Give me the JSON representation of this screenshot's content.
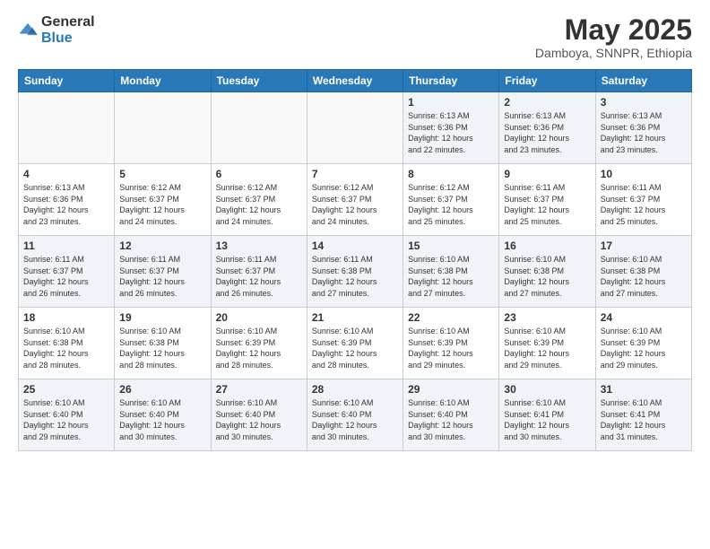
{
  "logo": {
    "line1": "General",
    "line2": "Blue"
  },
  "title": "May 2025",
  "location": "Damboya, SNNPR, Ethiopia",
  "weekdays": [
    "Sunday",
    "Monday",
    "Tuesday",
    "Wednesday",
    "Thursday",
    "Friday",
    "Saturday"
  ],
  "weeks": [
    [
      {
        "day": "",
        "info": ""
      },
      {
        "day": "",
        "info": ""
      },
      {
        "day": "",
        "info": ""
      },
      {
        "day": "",
        "info": ""
      },
      {
        "day": "1",
        "info": "Sunrise: 6:13 AM\nSunset: 6:36 PM\nDaylight: 12 hours\nand 22 minutes."
      },
      {
        "day": "2",
        "info": "Sunrise: 6:13 AM\nSunset: 6:36 PM\nDaylight: 12 hours\nand 23 minutes."
      },
      {
        "day": "3",
        "info": "Sunrise: 6:13 AM\nSunset: 6:36 PM\nDaylight: 12 hours\nand 23 minutes."
      }
    ],
    [
      {
        "day": "4",
        "info": "Sunrise: 6:13 AM\nSunset: 6:36 PM\nDaylight: 12 hours\nand 23 minutes."
      },
      {
        "day": "5",
        "info": "Sunrise: 6:12 AM\nSunset: 6:37 PM\nDaylight: 12 hours\nand 24 minutes."
      },
      {
        "day": "6",
        "info": "Sunrise: 6:12 AM\nSunset: 6:37 PM\nDaylight: 12 hours\nand 24 minutes."
      },
      {
        "day": "7",
        "info": "Sunrise: 6:12 AM\nSunset: 6:37 PM\nDaylight: 12 hours\nand 24 minutes."
      },
      {
        "day": "8",
        "info": "Sunrise: 6:12 AM\nSunset: 6:37 PM\nDaylight: 12 hours\nand 25 minutes."
      },
      {
        "day": "9",
        "info": "Sunrise: 6:11 AM\nSunset: 6:37 PM\nDaylight: 12 hours\nand 25 minutes."
      },
      {
        "day": "10",
        "info": "Sunrise: 6:11 AM\nSunset: 6:37 PM\nDaylight: 12 hours\nand 25 minutes."
      }
    ],
    [
      {
        "day": "11",
        "info": "Sunrise: 6:11 AM\nSunset: 6:37 PM\nDaylight: 12 hours\nand 26 minutes."
      },
      {
        "day": "12",
        "info": "Sunrise: 6:11 AM\nSunset: 6:37 PM\nDaylight: 12 hours\nand 26 minutes."
      },
      {
        "day": "13",
        "info": "Sunrise: 6:11 AM\nSunset: 6:37 PM\nDaylight: 12 hours\nand 26 minutes."
      },
      {
        "day": "14",
        "info": "Sunrise: 6:11 AM\nSunset: 6:38 PM\nDaylight: 12 hours\nand 27 minutes."
      },
      {
        "day": "15",
        "info": "Sunrise: 6:10 AM\nSunset: 6:38 PM\nDaylight: 12 hours\nand 27 minutes."
      },
      {
        "day": "16",
        "info": "Sunrise: 6:10 AM\nSunset: 6:38 PM\nDaylight: 12 hours\nand 27 minutes."
      },
      {
        "day": "17",
        "info": "Sunrise: 6:10 AM\nSunset: 6:38 PM\nDaylight: 12 hours\nand 27 minutes."
      }
    ],
    [
      {
        "day": "18",
        "info": "Sunrise: 6:10 AM\nSunset: 6:38 PM\nDaylight: 12 hours\nand 28 minutes."
      },
      {
        "day": "19",
        "info": "Sunrise: 6:10 AM\nSunset: 6:38 PM\nDaylight: 12 hours\nand 28 minutes."
      },
      {
        "day": "20",
        "info": "Sunrise: 6:10 AM\nSunset: 6:39 PM\nDaylight: 12 hours\nand 28 minutes."
      },
      {
        "day": "21",
        "info": "Sunrise: 6:10 AM\nSunset: 6:39 PM\nDaylight: 12 hours\nand 28 minutes."
      },
      {
        "day": "22",
        "info": "Sunrise: 6:10 AM\nSunset: 6:39 PM\nDaylight: 12 hours\nand 29 minutes."
      },
      {
        "day": "23",
        "info": "Sunrise: 6:10 AM\nSunset: 6:39 PM\nDaylight: 12 hours\nand 29 minutes."
      },
      {
        "day": "24",
        "info": "Sunrise: 6:10 AM\nSunset: 6:39 PM\nDaylight: 12 hours\nand 29 minutes."
      }
    ],
    [
      {
        "day": "25",
        "info": "Sunrise: 6:10 AM\nSunset: 6:40 PM\nDaylight: 12 hours\nand 29 minutes."
      },
      {
        "day": "26",
        "info": "Sunrise: 6:10 AM\nSunset: 6:40 PM\nDaylight: 12 hours\nand 30 minutes."
      },
      {
        "day": "27",
        "info": "Sunrise: 6:10 AM\nSunset: 6:40 PM\nDaylight: 12 hours\nand 30 minutes."
      },
      {
        "day": "28",
        "info": "Sunrise: 6:10 AM\nSunset: 6:40 PM\nDaylight: 12 hours\nand 30 minutes."
      },
      {
        "day": "29",
        "info": "Sunrise: 6:10 AM\nSunset: 6:40 PM\nDaylight: 12 hours\nand 30 minutes."
      },
      {
        "day": "30",
        "info": "Sunrise: 6:10 AM\nSunset: 6:41 PM\nDaylight: 12 hours\nand 30 minutes."
      },
      {
        "day": "31",
        "info": "Sunrise: 6:10 AM\nSunset: 6:41 PM\nDaylight: 12 hours\nand 31 minutes."
      }
    ]
  ]
}
